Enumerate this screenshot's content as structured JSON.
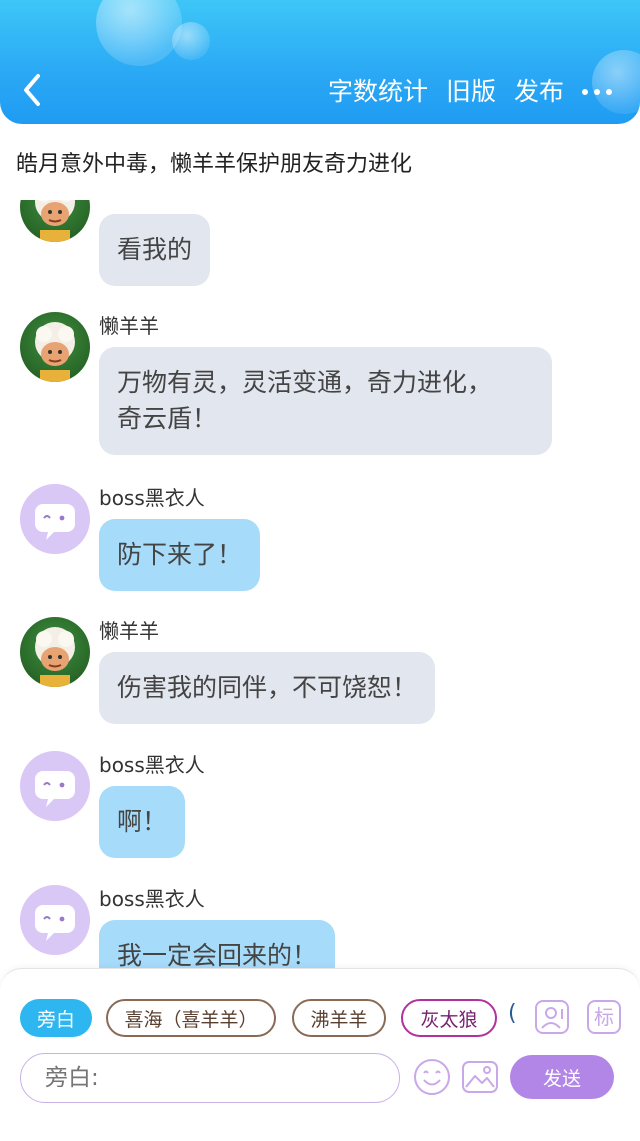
{
  "header": {
    "actions": [
      "字数统计",
      "旧版",
      "发布"
    ],
    "back_icon": "chevron-left-icon",
    "more_icon": "more-dots-icon",
    "gradient_colors": [
      "#3ec6f7",
      "#1f9cf2"
    ]
  },
  "title": "皓月意外中毒，懒羊羊保护朋友奇力进化",
  "messages": [
    {
      "sender": "",
      "avatar": "lazy-sheep",
      "text": "看我的",
      "bubble_color": "#e2e6ee"
    },
    {
      "sender": "懒羊羊",
      "avatar": "lazy-sheep",
      "lines": [
        "万物有灵，灵活变通，奇力进化，",
        "奇云盾！"
      ],
      "bubble_color": "#e2e6ee"
    },
    {
      "sender": "boss黑衣人",
      "avatar": "boss-placeholder",
      "text": "防下来了！",
      "bubble_color": "#a6dbfa"
    },
    {
      "sender": "懒羊羊",
      "avatar": "lazy-sheep",
      "text": "伤害我的同伴，不可饶恕！",
      "bubble_color": "#e2e6ee"
    },
    {
      "sender": "boss黑衣人",
      "avatar": "boss-placeholder",
      "text": "啊！",
      "bubble_color": "#a6dbfa"
    },
    {
      "sender": "boss黑衣人",
      "avatar": "boss-placeholder",
      "text": "我一定会回来的！",
      "bubble_color": "#a6dbfa"
    }
  ],
  "role_chips": [
    {
      "label": "旁白",
      "style": "active",
      "color": "#2eb6f0"
    },
    {
      "label": "喜海（喜羊羊）",
      "style": "outline",
      "color": "#8a6a55"
    },
    {
      "label": "沸羊羊",
      "style": "outline",
      "color": "#8a6a55"
    },
    {
      "label": "灰太狼",
      "style": "outline",
      "color": "#b0329e"
    },
    {
      "label": "(",
      "style": "partial",
      "color": "#2a5a9a"
    }
  ],
  "tools": {
    "character_icon": "character-card-icon",
    "tag_label": "标",
    "emoji_icon": "emoji-icon",
    "image_icon": "image-icon"
  },
  "input": {
    "placeholder": "旁白:"
  },
  "send": {
    "label": "发送",
    "color": "#b286e6"
  }
}
